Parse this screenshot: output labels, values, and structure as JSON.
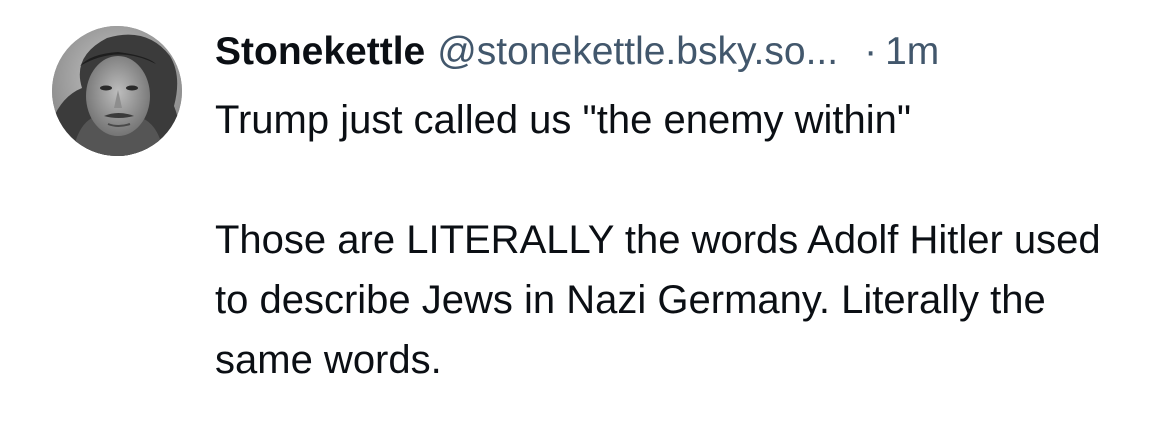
{
  "post": {
    "author": {
      "display_name": "Stonekettle",
      "handle": "@stonekettle.bsky.so...",
      "avatar": "grayscale-portrait-man-in-hood"
    },
    "separator": "·",
    "timestamp": "1m",
    "paragraphs": [
      "Trump just called us \"the enemy within\"",
      "Those are LITERALLY the words Adolf Hitler used to describe Jews in Nazi Germany. Literally the same words."
    ]
  },
  "colors": {
    "text_primary": "#0b0f14",
    "text_secondary": "#42576c",
    "background": "#ffffff"
  }
}
